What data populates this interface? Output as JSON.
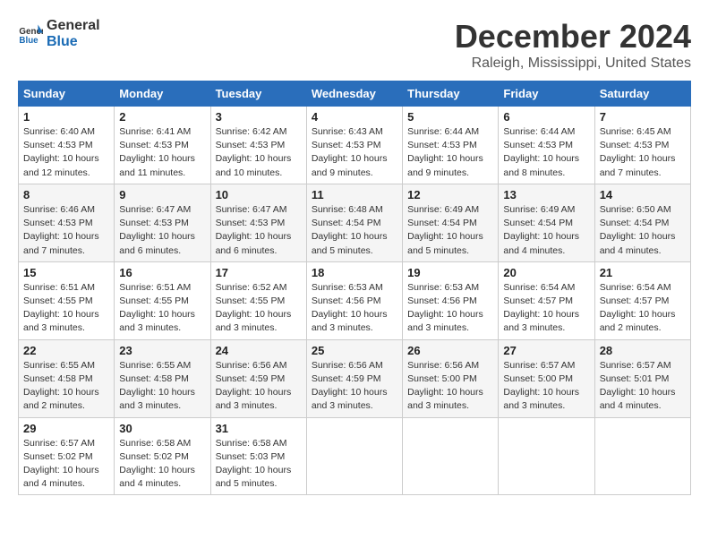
{
  "logo": {
    "line1": "General",
    "line2": "Blue"
  },
  "header": {
    "month": "December 2024",
    "location": "Raleigh, Mississippi, United States"
  },
  "days_of_week": [
    "Sunday",
    "Monday",
    "Tuesday",
    "Wednesday",
    "Thursday",
    "Friday",
    "Saturday"
  ],
  "weeks": [
    [
      {
        "day": "1",
        "sunrise": "6:40 AM",
        "sunset": "4:53 PM",
        "daylight": "10 hours and 12 minutes."
      },
      {
        "day": "2",
        "sunrise": "6:41 AM",
        "sunset": "4:53 PM",
        "daylight": "10 hours and 11 minutes."
      },
      {
        "day": "3",
        "sunrise": "6:42 AM",
        "sunset": "4:53 PM",
        "daylight": "10 hours and 10 minutes."
      },
      {
        "day": "4",
        "sunrise": "6:43 AM",
        "sunset": "4:53 PM",
        "daylight": "10 hours and 9 minutes."
      },
      {
        "day": "5",
        "sunrise": "6:44 AM",
        "sunset": "4:53 PM",
        "daylight": "10 hours and 9 minutes."
      },
      {
        "day": "6",
        "sunrise": "6:44 AM",
        "sunset": "4:53 PM",
        "daylight": "10 hours and 8 minutes."
      },
      {
        "day": "7",
        "sunrise": "6:45 AM",
        "sunset": "4:53 PM",
        "daylight": "10 hours and 7 minutes."
      }
    ],
    [
      {
        "day": "8",
        "sunrise": "6:46 AM",
        "sunset": "4:53 PM",
        "daylight": "10 hours and 7 minutes."
      },
      {
        "day": "9",
        "sunrise": "6:47 AM",
        "sunset": "4:53 PM",
        "daylight": "10 hours and 6 minutes."
      },
      {
        "day": "10",
        "sunrise": "6:47 AM",
        "sunset": "4:53 PM",
        "daylight": "10 hours and 6 minutes."
      },
      {
        "day": "11",
        "sunrise": "6:48 AM",
        "sunset": "4:54 PM",
        "daylight": "10 hours and 5 minutes."
      },
      {
        "day": "12",
        "sunrise": "6:49 AM",
        "sunset": "4:54 PM",
        "daylight": "10 hours and 5 minutes."
      },
      {
        "day": "13",
        "sunrise": "6:49 AM",
        "sunset": "4:54 PM",
        "daylight": "10 hours and 4 minutes."
      },
      {
        "day": "14",
        "sunrise": "6:50 AM",
        "sunset": "4:54 PM",
        "daylight": "10 hours and 4 minutes."
      }
    ],
    [
      {
        "day": "15",
        "sunrise": "6:51 AM",
        "sunset": "4:55 PM",
        "daylight": "10 hours and 3 minutes."
      },
      {
        "day": "16",
        "sunrise": "6:51 AM",
        "sunset": "4:55 PM",
        "daylight": "10 hours and 3 minutes."
      },
      {
        "day": "17",
        "sunrise": "6:52 AM",
        "sunset": "4:55 PM",
        "daylight": "10 hours and 3 minutes."
      },
      {
        "day": "18",
        "sunrise": "6:53 AM",
        "sunset": "4:56 PM",
        "daylight": "10 hours and 3 minutes."
      },
      {
        "day": "19",
        "sunrise": "6:53 AM",
        "sunset": "4:56 PM",
        "daylight": "10 hours and 3 minutes."
      },
      {
        "day": "20",
        "sunrise": "6:54 AM",
        "sunset": "4:57 PM",
        "daylight": "10 hours and 3 minutes."
      },
      {
        "day": "21",
        "sunrise": "6:54 AM",
        "sunset": "4:57 PM",
        "daylight": "10 hours and 2 minutes."
      }
    ],
    [
      {
        "day": "22",
        "sunrise": "6:55 AM",
        "sunset": "4:58 PM",
        "daylight": "10 hours and 2 minutes."
      },
      {
        "day": "23",
        "sunrise": "6:55 AM",
        "sunset": "4:58 PM",
        "daylight": "10 hours and 3 minutes."
      },
      {
        "day": "24",
        "sunrise": "6:56 AM",
        "sunset": "4:59 PM",
        "daylight": "10 hours and 3 minutes."
      },
      {
        "day": "25",
        "sunrise": "6:56 AM",
        "sunset": "4:59 PM",
        "daylight": "10 hours and 3 minutes."
      },
      {
        "day": "26",
        "sunrise": "6:56 AM",
        "sunset": "5:00 PM",
        "daylight": "10 hours and 3 minutes."
      },
      {
        "day": "27",
        "sunrise": "6:57 AM",
        "sunset": "5:00 PM",
        "daylight": "10 hours and 3 minutes."
      },
      {
        "day": "28",
        "sunrise": "6:57 AM",
        "sunset": "5:01 PM",
        "daylight": "10 hours and 4 minutes."
      }
    ],
    [
      {
        "day": "29",
        "sunrise": "6:57 AM",
        "sunset": "5:02 PM",
        "daylight": "10 hours and 4 minutes."
      },
      {
        "day": "30",
        "sunrise": "6:58 AM",
        "sunset": "5:02 PM",
        "daylight": "10 hours and 4 minutes."
      },
      {
        "day": "31",
        "sunrise": "6:58 AM",
        "sunset": "5:03 PM",
        "daylight": "10 hours and 5 minutes."
      },
      null,
      null,
      null,
      null
    ]
  ]
}
